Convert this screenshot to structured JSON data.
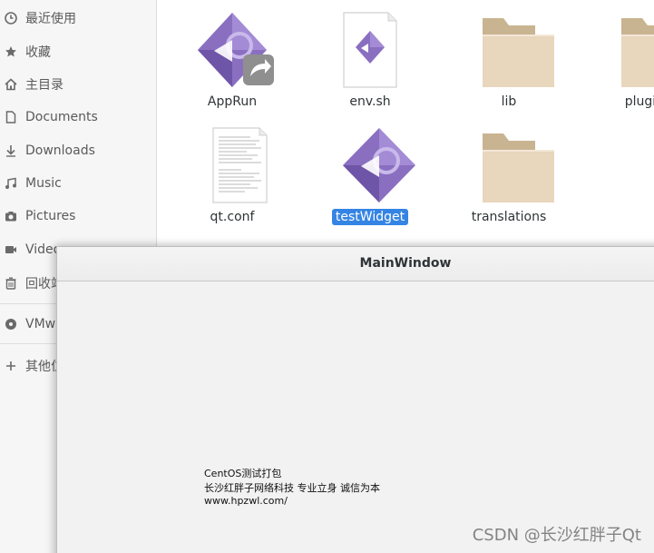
{
  "sidebar": {
    "items": [
      {
        "label": "最近使用",
        "icon": "clock-icon"
      },
      {
        "label": "收藏",
        "icon": "star-icon"
      },
      {
        "label": "主目录",
        "icon": "home-icon"
      },
      {
        "label": "Documents",
        "icon": "document-icon"
      },
      {
        "label": "Downloads",
        "icon": "download-icon"
      },
      {
        "label": "Music",
        "icon": "music-icon"
      },
      {
        "label": "Pictures",
        "icon": "camera-icon"
      },
      {
        "label": "Videos",
        "icon": "video-icon"
      },
      {
        "label": "回收站",
        "icon": "trash-icon"
      },
      {
        "label": "VMware Tools",
        "icon": "disc-icon"
      },
      {
        "label": "其他位置",
        "icon": "plus-icon"
      }
    ]
  },
  "files": [
    {
      "name": "AppRun",
      "icon": "qt-symlink-icon"
    },
    {
      "name": "env.sh",
      "icon": "script-file-icon"
    },
    {
      "name": "lib",
      "icon": "folder-icon"
    },
    {
      "name": "plugins",
      "icon": "folder-icon"
    },
    {
      "name": "qt.conf",
      "icon": "text-file-icon"
    },
    {
      "name": "testWidget",
      "icon": "qt-executable-icon",
      "selected": true
    },
    {
      "name": "translations",
      "icon": "folder-icon"
    }
  ],
  "main_window": {
    "title": "MainWindow",
    "lines": [
      "CentOS测试打包",
      "长沙红胖子网络科技 专业立身 诚信为本",
      "www.hpzwl.com/"
    ]
  },
  "watermark": "CSDN @长沙红胖子Qt",
  "colors": {
    "selection": "#3584e4",
    "qt_purple": "#8a6fc1",
    "folder_tan": "#e8d6bd"
  }
}
